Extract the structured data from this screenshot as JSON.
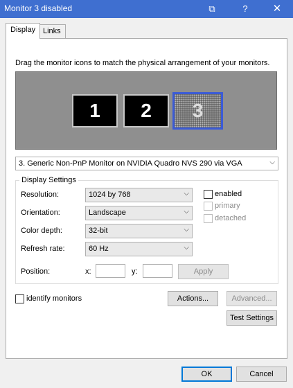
{
  "window": {
    "title": "Monitor 3 disabled",
    "restore_glyph": "⧉",
    "help_glyph": "?",
    "close_glyph": "✕"
  },
  "tabs": [
    {
      "label": "Display",
      "active": true
    },
    {
      "label": "Links",
      "active": false
    }
  ],
  "instruction": "Drag the monitor icons to match the physical arrangement of your monitors.",
  "monitors": [
    {
      "label": "1",
      "state": "normal"
    },
    {
      "label": "2",
      "state": "normal"
    },
    {
      "label": "3",
      "state": "disabled-selected"
    }
  ],
  "monitor_select": {
    "value": "3. Generic Non-PnP Monitor on NVIDIA Quadro NVS 290 via VGA"
  },
  "display_settings": {
    "group_label": "Display Settings",
    "resolution": {
      "label": "Resolution:",
      "value": "1024 by 768"
    },
    "orientation": {
      "label": "Orientation:",
      "value": "Landscape"
    },
    "color_depth": {
      "label": "Color depth:",
      "value": "32-bit"
    },
    "refresh_rate": {
      "label": "Refresh rate:",
      "value": "60 Hz"
    },
    "position": {
      "label": "Position:",
      "x_label": "x:",
      "y_label": "y:",
      "x_value": "",
      "y_value": ""
    },
    "apply_label": "Apply",
    "enabled_label": "enabled",
    "primary_label": "primary",
    "detached_label": "detached"
  },
  "identify": {
    "label": "identify monitors"
  },
  "buttons": {
    "actions": "Actions...",
    "advanced": "Advanced...",
    "test_settings": "Test Settings",
    "ok": "OK",
    "cancel": "Cancel"
  },
  "colors": {
    "titlebar": "#3f6fd0",
    "selection_border": "#3b5bd6"
  }
}
